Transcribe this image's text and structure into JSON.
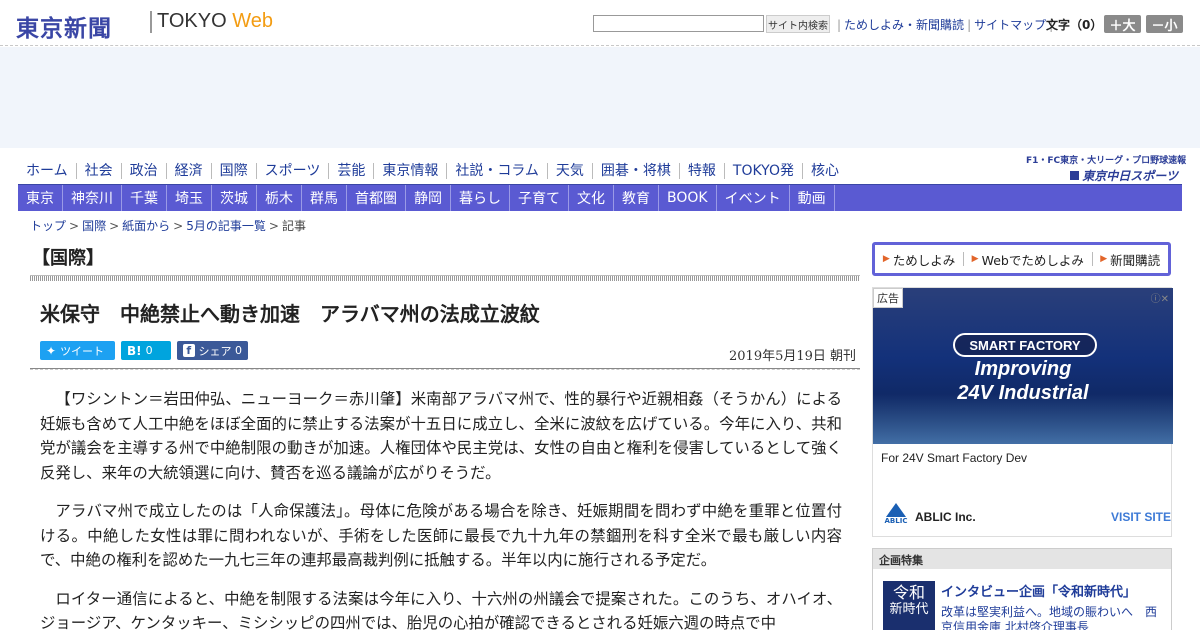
{
  "header": {
    "logo_jp": "東京新聞",
    "logo_en_prefix": "TOKYO",
    "logo_en_suffix": "Web",
    "search_placeholder": "",
    "search_button": "サイト内検索",
    "links": [
      "ためしよみ・新聞購読",
      "サイトマップ"
    ],
    "font_size_label": "文字（0）",
    "font_plus": "＋大",
    "font_minus": "－小"
  },
  "global_nav": [
    "ホーム",
    "社会",
    "政治",
    "経済",
    "国際",
    "スポーツ",
    "芸能",
    "東京情報",
    "社説・コラム",
    "天気",
    "囲碁・将棋",
    "特報",
    "TOKYO発",
    "核心"
  ],
  "sports_logo": {
    "top": "F1・FC東京・大リーグ・プロ野球速報",
    "bottom": "東京中日スポーツ"
  },
  "local_nav": [
    "東京",
    "神奈川",
    "千葉",
    "埼玉",
    "茨城",
    "栃木",
    "群馬",
    "首都圏",
    "静岡",
    "暮らし",
    "子育て",
    "文化",
    "教育",
    "BOOK",
    "イベント",
    "動画"
  ],
  "breadcrumb": [
    "トップ",
    "国際",
    "紙面から",
    "5月の記事一覧",
    "記事"
  ],
  "article": {
    "section": "【国際】",
    "headline": "米保守　中絶禁止へ動き加速　アラバマ州の法成立波紋",
    "share": {
      "tweet": "ツイート",
      "hatena_icon": "B!",
      "hatena_count": "0",
      "facebook_icon": "f",
      "facebook": "シェア",
      "facebook_count": "0"
    },
    "date": "2019年5月19日 朝刊",
    "paragraphs": [
      "【ワシントン＝岩田仲弘、ニューヨーク＝赤川肇】米南部アラバマ州で、性的暴行や近親相姦（そうかん）による妊娠も含めて人工中絶をほぼ全面的に禁止する法案が十五日に成立し、全米に波紋を広げている。今年に入り、共和党が議会を主導する州で中絶制限の動きが加速。人権団体や民主党は、女性の自由と権利を侵害しているとして強く反発し、来年の大統領選に向け、賛否を巡る議論が広がりそうだ。",
      "アラバマ州で成立したのは「人命保護法」。母体に危険がある場合を除き、妊娠期間を問わず中絶を重罪と位置付ける。中絶した女性は罪に問われないが、手術をした医師に最長で九十九年の禁錮刑を科す全米で最も厳しい内容で、中絶の権利を認めた一九七三年の連邦最高裁判例に抵触する。半年以内に施行される予定だ。",
      "ロイター通信によると、中絶を制限する法案は今年に入り、十六州の州議会で提案された。このうち、オハイオ、ジョージア、ケンタッキー、ミシシッピの四州では、胎児の心拍が確認できるとされる妊娠六週の時点で中"
    ]
  },
  "sidebar": {
    "subscribe_links": [
      "ためしよみ",
      "Webでためしよみ",
      "新聞購読"
    ],
    "ad": {
      "label": "広告",
      "badge": "SMART FACTORY",
      "line1": "Improving",
      "line2": "24V Industrial",
      "caption": "For 24V Smart Factory Dev",
      "logo_text": "ABLIC",
      "brand": "ABLIC Inc.",
      "cta": "VISIT SITE"
    },
    "feature": {
      "heading": "企画特集",
      "thumb_line1": "令和",
      "thumb_line2": "新時代",
      "title": "インタビュー企画「令和新時代」",
      "desc": "改革は堅実利益へ。地域の賑わいへ　西京信用金庫 北村啓介理事長"
    }
  },
  "colors": {
    "brand_blue": "#3a46a5",
    "local_nav_bg": "#5a5ad2",
    "link": "#1f3c99",
    "accent_orange": "#f39c12"
  }
}
